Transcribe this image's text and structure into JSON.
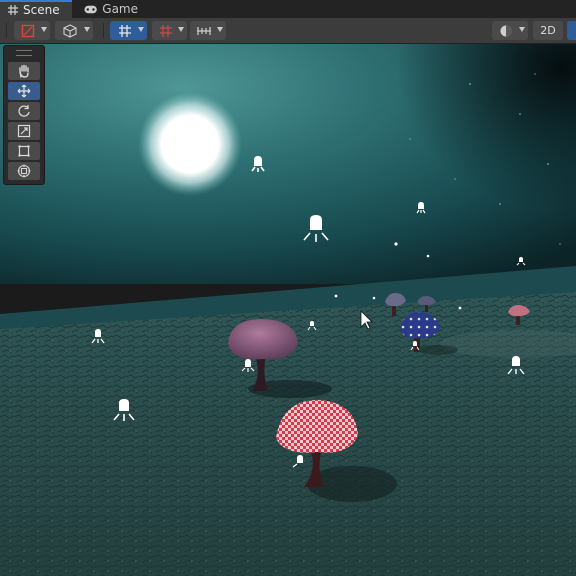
{
  "tabs": [
    {
      "label": "Scene",
      "icon": "grid-icon",
      "active": true
    },
    {
      "label": "Game",
      "icon": "gamepad-icon",
      "active": false
    }
  ],
  "toolbar": {
    "buttons": [
      {
        "name": "draw-mode-dropdown",
        "icon": "shading-icon"
      },
      {
        "name": "view-options-dropdown",
        "icon": "cube-icon"
      },
      {
        "name": "grid-snapping-dropdown",
        "icon": "grid-snap-icon",
        "pressed": true
      },
      {
        "name": "increment-snap-dropdown",
        "icon": "snap-increment-icon"
      },
      {
        "name": "scene-visibility-dropdown",
        "icon": "ruler-icon"
      },
      {
        "name": "render-mode-dropdown",
        "icon": "sphere-icon"
      }
    ],
    "two_d_label": "2D"
  },
  "tools": [
    {
      "name": "hand-tool",
      "icon": "hand-icon",
      "active": false
    },
    {
      "name": "move-tool",
      "icon": "move-icon",
      "active": true
    },
    {
      "name": "rotate-tool",
      "icon": "rotate-icon",
      "active": false
    },
    {
      "name": "scale-tool",
      "icon": "scale-icon",
      "active": false
    },
    {
      "name": "rect-tool",
      "icon": "rect-icon",
      "active": false
    },
    {
      "name": "transform-tool",
      "icon": "transform-icon",
      "active": false
    }
  ],
  "colors": {
    "accent": "#3a7ad0",
    "sky": "#1e5a5e",
    "ground": "#2c4a4a",
    "moon": "#ffffff",
    "mushroom_red": "#d9374a",
    "mushroom_purple": "#6e4a6a",
    "mushroom_blue": "#2a3a8a"
  }
}
